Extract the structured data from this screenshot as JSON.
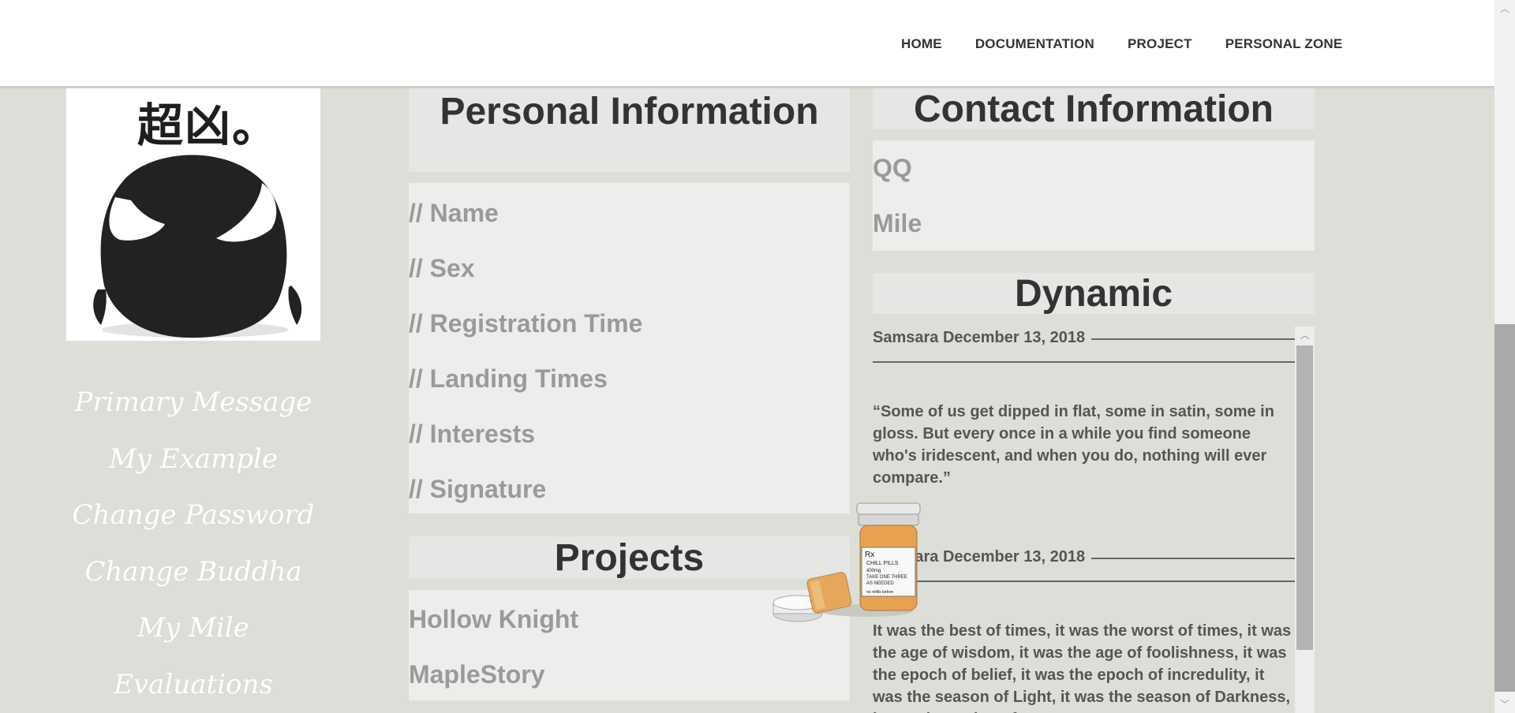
{
  "nav": {
    "items": [
      "HOME",
      "DOCUMENTATION",
      "PROJECT",
      "PERSONAL ZONE"
    ]
  },
  "avatar": {
    "caption": "超凶。"
  },
  "side_menu": {
    "items": [
      "Primary Message",
      "My Example",
      "Change Password",
      "Change Buddha",
      "My Mile",
      "Evaluations"
    ]
  },
  "personal_info": {
    "title": "Personal Information",
    "fields": [
      "// Name",
      "// Sex",
      "// Registration Time",
      "// Landing Times",
      "// Interests",
      "// Signature"
    ]
  },
  "projects": {
    "title": "Projects",
    "items": [
      "Hollow Knight",
      "MapleStory"
    ]
  },
  "contact": {
    "title": "Contact Information",
    "fields": [
      "QQ",
      "Mile"
    ]
  },
  "dynamic": {
    "title": "Dynamic",
    "posts": [
      {
        "meta": "Samsara December 13, 2018",
        "body": "“Some of us get dipped in flat, some in satin, some in gloss. But every once in a while you find someone who's iridescent, and when you do, nothing will ever compare.”"
      },
      {
        "meta": "Samsara December 13, 2018",
        "body": "It was the best of times, it was the worst of times, it was the age of wisdom, it was the age of foolishness, it was the epoch of belief, it was the epoch of incredulity, it was the season of Light, it was the season of Darkness, it was the spring of"
      }
    ]
  },
  "decoration": {
    "pill_label_lines": [
      "Rx",
      "CHILL PILLS",
      "400mg",
      "TAKE ONE THREE",
      "AS NEEDED",
      "no refills before"
    ]
  },
  "colors": {
    "page_bg": "#dcdfd8",
    "panel_head_bg": "#e6e6e4",
    "panel_body_bg": "#ededeb",
    "field_text": "#9a9a9a",
    "heading_text": "#333333"
  }
}
